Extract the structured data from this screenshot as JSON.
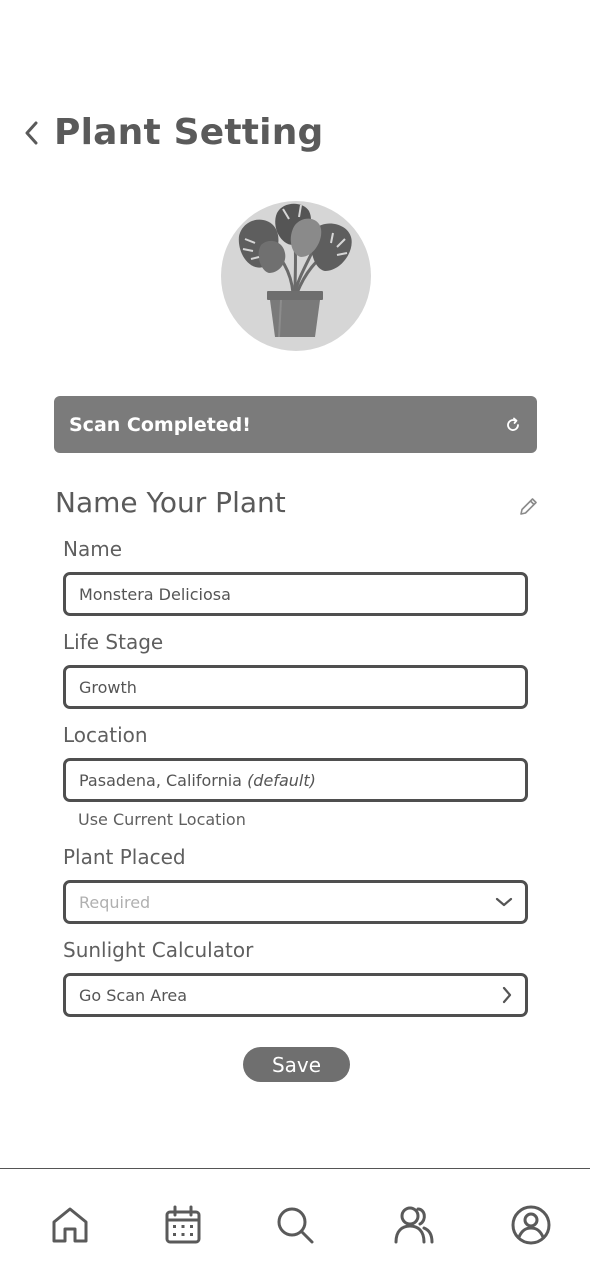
{
  "header": {
    "title": "Plant Setting",
    "back_icon": "chevron-left-icon"
  },
  "plant_image": {
    "icon": "potted-plant-icon"
  },
  "scan_banner": {
    "text": "Scan Completed!",
    "icon": "refresh-icon",
    "background": "#7b7b7b"
  },
  "section": {
    "title": "Name Your Plant",
    "edit_icon": "pencil-icon"
  },
  "fields": {
    "name": {
      "label": "Name",
      "value": "Monstera Deliciosa"
    },
    "life_stage": {
      "label": "Life Stage",
      "value": "Growth"
    },
    "location": {
      "label": "Location",
      "value": "Pasadena, California",
      "suffix": "(default)"
    },
    "use_current_location": "Use Current Location",
    "plant_placed": {
      "label": "Plant Placed",
      "placeholder": "Required",
      "icon": "chevron-down-icon"
    },
    "sunlight": {
      "label": "Sunlight Calculator",
      "value": "Go Scan Area",
      "icon": "chevron-right-icon"
    }
  },
  "save_label": "Save",
  "nav": {
    "items": [
      {
        "icon": "home-icon"
      },
      {
        "icon": "calendar-icon"
      },
      {
        "icon": "search-icon"
      },
      {
        "icon": "community-icon"
      },
      {
        "icon": "profile-icon"
      }
    ]
  }
}
